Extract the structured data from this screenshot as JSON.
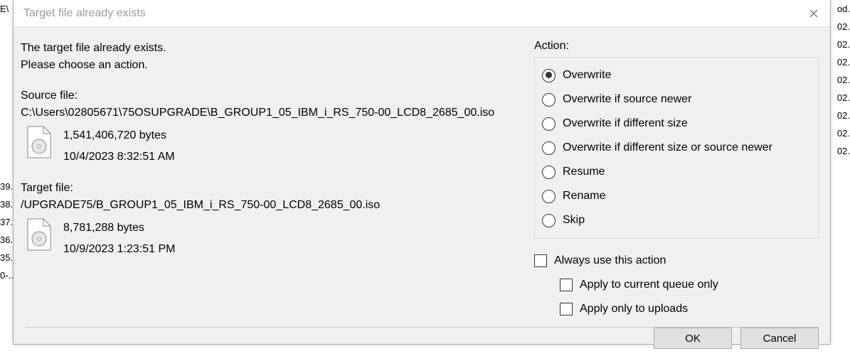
{
  "dialog": {
    "title": "Target file already exists",
    "message_line1": "The target file already exists.",
    "message_line2": "Please choose an action.",
    "source": {
      "label": "Source file:",
      "path": "C:\\Users\\02805671\\75OSUPGRADE\\B_GROUP1_05_IBM_i_RS_750-00_LCD8_2685_00.iso",
      "size": "1,541,406,720 bytes",
      "date": "10/4/2023 8:32:51 AM"
    },
    "target": {
      "label": "Target file:",
      "path": "/UPGRADE75/B_GROUP1_05_IBM_i_RS_750-00_LCD8_2685_00.iso",
      "size": "8,781,288 bytes",
      "date": "10/9/2023 1:23:51 PM"
    },
    "action_label": "Action:",
    "actions": [
      {
        "label": "Overwrite",
        "selected": true
      },
      {
        "label": "Overwrite if source newer",
        "selected": false
      },
      {
        "label": "Overwrite if different size",
        "selected": false
      },
      {
        "label": "Overwrite if different size or source newer",
        "selected": false
      },
      {
        "label": "Resume",
        "selected": false
      },
      {
        "label": "Rename",
        "selected": false
      },
      {
        "label": "Skip",
        "selected": false
      }
    ],
    "always": {
      "label": "Always use this action",
      "sub1": "Apply to current queue only",
      "sub2": "Apply only to uploads"
    },
    "buttons": {
      "ok": "OK",
      "cancel": "Cancel"
    }
  },
  "background": {
    "left": [
      "E\\",
      "",
      "",
      "",
      "",
      "",
      "",
      "",
      "",
      "",
      "39.",
      "38.",
      "37.",
      "36.",
      "35.",
      "0-..."
    ],
    "right": [
      "",
      "",
      "",
      "",
      "",
      "",
      "",
      "",
      "od.",
      "",
      "02.",
      "02.",
      "02.",
      "02.",
      "02.",
      "02.",
      "02.",
      "02."
    ]
  }
}
